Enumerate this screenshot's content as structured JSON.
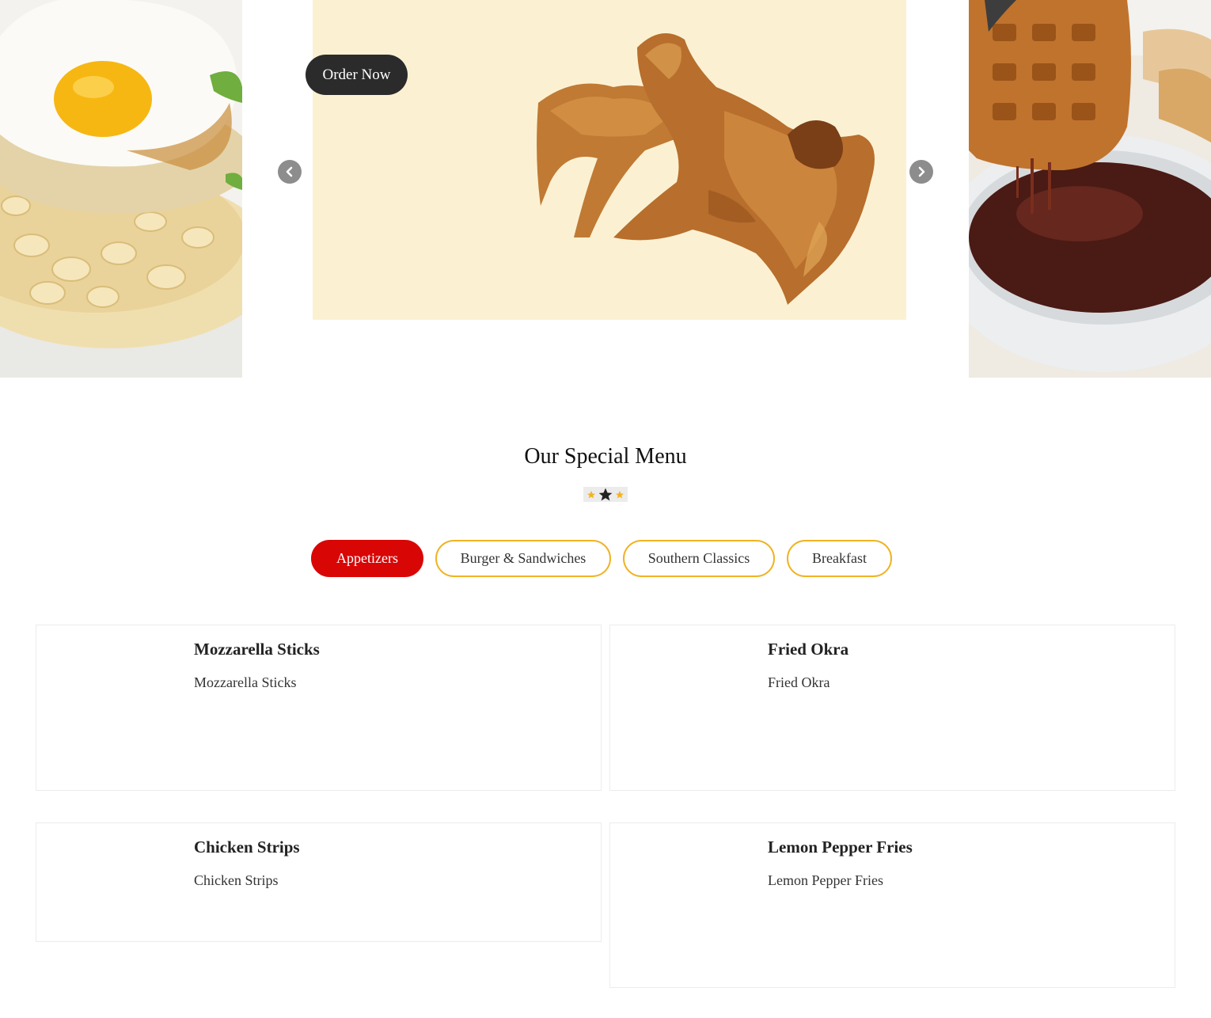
{
  "hero": {
    "order_button": "Order Now",
    "prev_icon": "chevron-left-icon",
    "next_icon": "chevron-right-icon"
  },
  "menu": {
    "title": "Our Special Menu",
    "tabs": [
      {
        "label": "Appetizers",
        "active": true
      },
      {
        "label": "Burger & Sandwiches",
        "active": false
      },
      {
        "label": "Southern Classics",
        "active": false
      },
      {
        "label": "Breakfast",
        "active": false
      }
    ],
    "items": [
      {
        "title": "Mozzarella Sticks",
        "description": "Mozzarella Sticks"
      },
      {
        "title": "Fried Okra",
        "description": "Fried Okra"
      },
      {
        "title": "Chicken Strips",
        "description": "Chicken Strips"
      },
      {
        "title": "Lemon Pepper Fries",
        "description": "Lemon Pepper Fries"
      }
    ]
  },
  "colors": {
    "active_tab": "#d90606",
    "tab_border": "#f0b323",
    "order_button": "#2b2b2b",
    "slide_background": "#fbf1d2"
  }
}
